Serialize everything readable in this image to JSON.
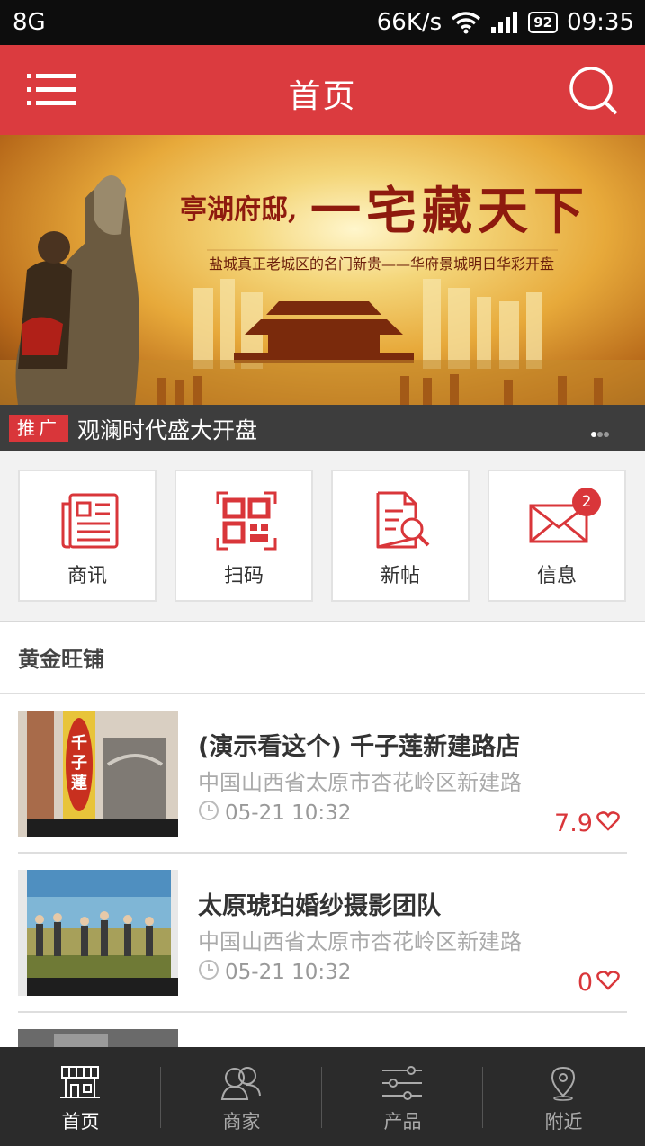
{
  "status_bar": {
    "carrier": "8G",
    "speed": "66K/s",
    "battery": "92",
    "time": "09:35"
  },
  "header": {
    "title": "首页",
    "menu_icon": "menu-icon",
    "search_icon": "search-icon",
    "color": "#db3b3f"
  },
  "banner": {
    "slogan_small": "亭湖府邸,",
    "slogan_big": "一宅藏天下",
    "subtitle": "盐城真正老城区的名门新贵——华府景城明日华彩开盘"
  },
  "promo": {
    "tag": "推广",
    "text": "观澜时代盛大开盘"
  },
  "quick_actions": [
    {
      "label": "商讯",
      "icon": "newspaper-icon"
    },
    {
      "label": "扫码",
      "icon": "qr-code-icon"
    },
    {
      "label": "新帖",
      "icon": "document-search-icon"
    },
    {
      "label": "信息",
      "icon": "envelope-icon",
      "badge": "2"
    }
  ],
  "section": {
    "title": "黄金旺铺",
    "items": [
      {
        "name": "(演示看这个) 千子莲新建路店",
        "address": "中国山西省太原市杏花岭区新建路",
        "time": "05-21 10:32",
        "score": "7.9",
        "thumb_sign": "千子蓮"
      },
      {
        "name": "太原琥珀婚纱摄影团队",
        "address": "中国山西省太原市杏花岭区新建路",
        "time": "05-21 10:32",
        "score": "0"
      }
    ]
  },
  "tab_bar": [
    {
      "label": "首页",
      "icon": "storefront-icon",
      "active": true
    },
    {
      "label": "商家",
      "icon": "merchants-icon"
    },
    {
      "label": "产品",
      "icon": "sliders-icon"
    },
    {
      "label": "附近",
      "icon": "location-pin-icon"
    }
  ],
  "colors": {
    "accent": "#d9363a",
    "tabbar": "#2b2b2b"
  }
}
